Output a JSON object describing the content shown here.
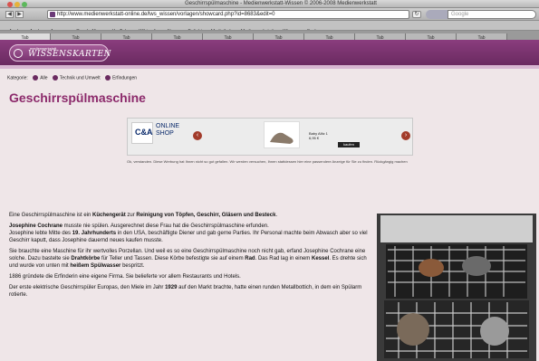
{
  "browser": {
    "window_title": "Geschirrspülmaschine - Medienwerkstatt-Wissen © 2006-2008 Medienwerkstatt",
    "url": "http://www.medienwerkstatt-online.de/lws_wissen/vorlagen/showcard.php?id=8683&edit=0",
    "search_placeholder": "Google",
    "nav_back": "◀",
    "nav_forward": "▶",
    "reload": "↻",
    "bookmarks": [
      "Apple",
      "Apple",
      "Amazon",
      "Google Maps",
      "YouTube",
      "Wikipedia",
      "News",
      "Beliebt",
      "Mediathek",
      "Medienwerkstatt",
      "Wissen",
      "Suche"
    ],
    "tabs": [
      "Tab",
      "Tab",
      "Tab",
      "Tab",
      "Tab",
      "Tab",
      "Tab",
      "Tab",
      "Tab",
      "Tab"
    ]
  },
  "site": {
    "logo_small": "medienwerkstatt",
    "logo_text": "WISSENSKARTEN"
  },
  "breadcrumb": {
    "label": "Kategorie:",
    "items": [
      "Alle",
      "Technik und Umwelt",
      "Erfindungen"
    ]
  },
  "page_title": "Geschirrspülmaschine",
  "ad": {
    "brand": "C&A",
    "shop_label": "ONLINE SHOP",
    "price_text": "Baby Alltz 1\n6,95 €",
    "buy_label": "kaufen",
    "prev": "‹",
    "next": "›",
    "note": "Ok, verstanden. Diese Werbung hat Ihnen nicht so gut gefallen. Wir werden versuchen, Ihnen stattdessen hier eine passendere Anzeige für Sie zu finden. Rückgängig machen"
  },
  "article": {
    "p1_a": "Eine Geschirrspülmaschine ist ein ",
    "p1_b": "Küchengerät",
    "p1_c": " zur ",
    "p1_d": "Reinigung von Töpfen, Geschirr, Gläsern und Besteck",
    "p1_e": ".",
    "p2_a": "Josephine Cochrane",
    "p2_b": " musste nie spülen. Ausgerechnet diese Frau hat die Geschirrspülmaschine erfunden.",
    "p2_c": "Josephine lebte Mitte des ",
    "p2_d": "19. Jahrhunderts",
    "p2_e": " in den USA, beschäftigte Diener und gab gerne Parties. Ihr Personal machte beim Abwasch aber so viel Geschirr kaputt, dass Josephine dauernd neues kaufen musste.",
    "p3_a": "Sie brauchte eine Maschine für ihr wertvolles Porzellan. Und weil es so eine Geschirrspülmaschine noch nicht gab, erfand Josephine Cochrane eine solche. Dazu bastelte sie ",
    "p3_b": "Drahtkörbe",
    "p3_c": " für Teller und Tassen. Diese Körbe befestigte sie auf einem ",
    "p3_d": "Rad",
    "p3_e": ". Das Rad lag in einem ",
    "p3_f": "Kessel",
    "p3_g": ". Es drehte sich und wurde von unten mit ",
    "p3_h": "heißem Spülwasser",
    "p3_i": " bespritzt.",
    "p4": "1886 gründete die Erfinderin eine eigene Firma. Sie belieferte vor allem Restaurants und Hotels.",
    "p5_a": "Der erste elektrische Geschirrspüler Europas, den Miele im Jahr ",
    "p5_b": "1929",
    "p5_c": " auf den Markt brachte, hatte einen runden Metallbottich, in dem ein Spülarm rotierte."
  }
}
